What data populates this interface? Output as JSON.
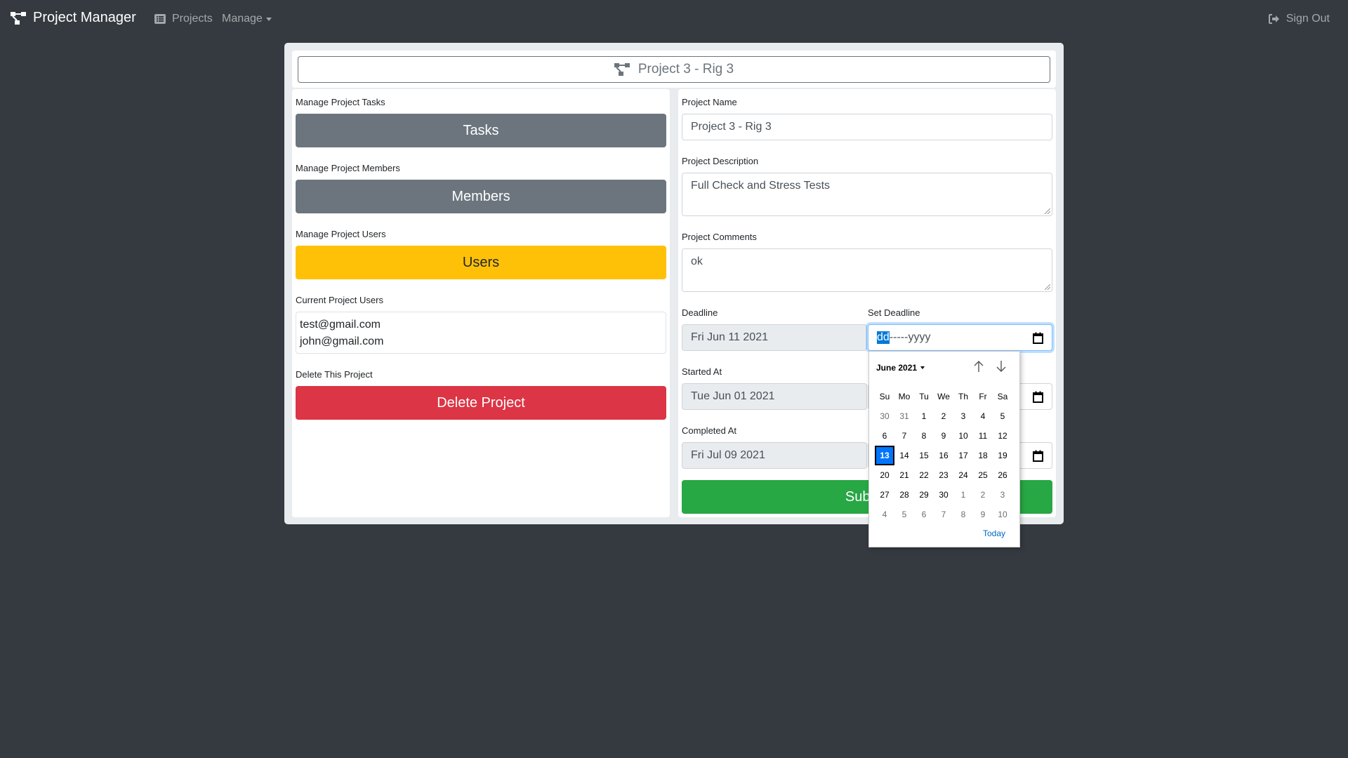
{
  "navbar": {
    "brand": "Project Manager",
    "projects": "Projects",
    "manage": "Manage",
    "sign_out": "Sign Out"
  },
  "title": "Project 3 - Rig 3",
  "left": {
    "tasks_label": "Manage Project Tasks",
    "tasks_button": "Tasks",
    "members_label": "Manage Project Members",
    "members_button": "Members",
    "users_label": "Manage Project Users",
    "users_button": "Users",
    "current_users_label": "Current Project Users",
    "current_users": [
      "test@gmail.com",
      "john@gmail.com"
    ],
    "delete_label": "Delete This Project",
    "delete_button": "Delete Project"
  },
  "right": {
    "name_label": "Project Name",
    "name_value": "Project 3 - Rig 3",
    "description_label": "Project Description",
    "description_value": "Full Check and Stress Tests",
    "comments_label": "Project Comments",
    "comments_value": "ok",
    "deadline_label": "Deadline",
    "deadline_value": "Fri Jun 11 2021",
    "set_deadline_label": "Set Deadline",
    "set_deadline_segments": {
      "day": "dd",
      "sep": "-----",
      "year": "yyyy"
    },
    "started_label": "Started At",
    "started_value": "Tue Jun 01 2021",
    "completed_label": "Completed At",
    "completed_value": "Fri Jul 09 2021",
    "submit_button": "Submit"
  },
  "datepicker": {
    "month_label": "June 2021",
    "weekdays": [
      "Su",
      "Mo",
      "Tu",
      "We",
      "Th",
      "Fr",
      "Sa"
    ],
    "days": [
      {
        "d": "30",
        "other": true
      },
      {
        "d": "31",
        "other": true
      },
      {
        "d": "1"
      },
      {
        "d": "2"
      },
      {
        "d": "3"
      },
      {
        "d": "4"
      },
      {
        "d": "5"
      },
      {
        "d": "6"
      },
      {
        "d": "7"
      },
      {
        "d": "8"
      },
      {
        "d": "9"
      },
      {
        "d": "10"
      },
      {
        "d": "11"
      },
      {
        "d": "12"
      },
      {
        "d": "13",
        "selected": true
      },
      {
        "d": "14"
      },
      {
        "d": "15"
      },
      {
        "d": "16"
      },
      {
        "d": "17"
      },
      {
        "d": "18"
      },
      {
        "d": "19"
      },
      {
        "d": "20"
      },
      {
        "d": "21"
      },
      {
        "d": "22"
      },
      {
        "d": "23"
      },
      {
        "d": "24"
      },
      {
        "d": "25"
      },
      {
        "d": "26"
      },
      {
        "d": "27"
      },
      {
        "d": "28"
      },
      {
        "d": "29"
      },
      {
        "d": "30"
      },
      {
        "d": "1",
        "other": true
      },
      {
        "d": "2",
        "other": true
      },
      {
        "d": "3",
        "other": true
      },
      {
        "d": "4",
        "other": true
      },
      {
        "d": "5",
        "other": true
      },
      {
        "d": "6",
        "other": true
      },
      {
        "d": "7",
        "other": true
      },
      {
        "d": "8",
        "other": true
      },
      {
        "d": "9",
        "other": true
      },
      {
        "d": "10",
        "other": true
      }
    ],
    "today_label": "Today"
  },
  "colors": {
    "navbar_bg": "#343a40",
    "secondary": "#6c757d",
    "warning": "#ffc107",
    "danger": "#dc3545",
    "success": "#28a745",
    "selected_day": "#0075ff"
  }
}
